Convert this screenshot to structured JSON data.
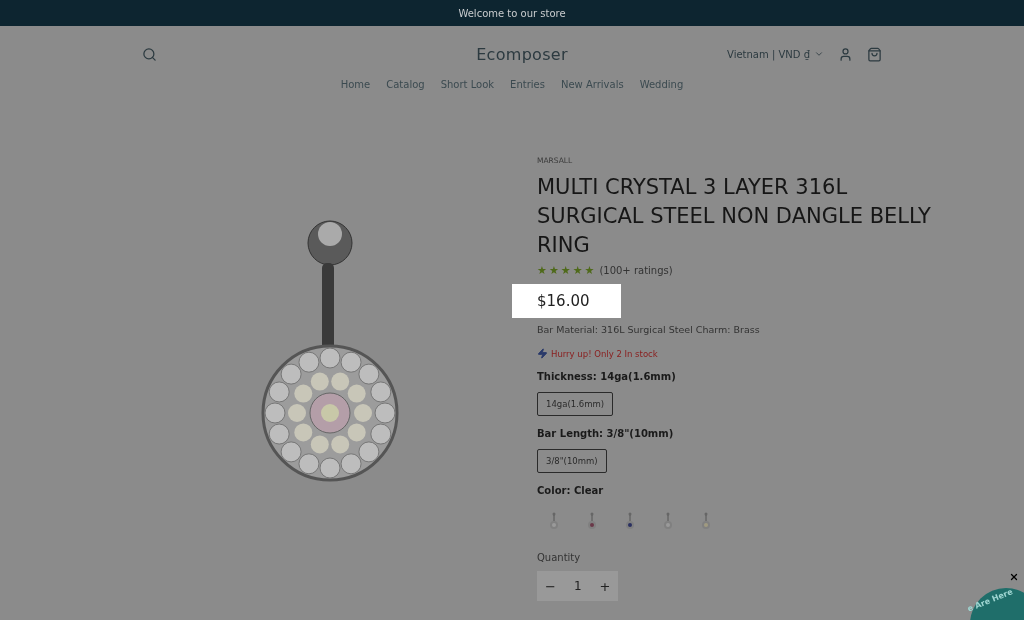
{
  "announcement": "Welcome to our store",
  "header": {
    "logo": "Ecomposer",
    "locale": "Vietnam | VND ₫"
  },
  "nav": [
    "Home",
    "Catalog",
    "Short Look",
    "Entries",
    "New Arrivals",
    "Wedding"
  ],
  "product": {
    "vendor": "MARSALL",
    "title": "MULTI CRYSTAL 3 LAYER 316L SURGICAL STEEL NON DANGLE BELLY RING",
    "stars": 5,
    "ratings": "(100+ ratings)",
    "price": "$16.00",
    "description": "Bar Material: 316L Surgical Steel Charm: Brass",
    "stock": "Hurry up! Only 2 In stock",
    "options": [
      {
        "label": "Thickness: 14ga(1.6mm)",
        "values": [
          {
            "label": "14ga(1.6mm)",
            "selected": true
          }
        ]
      },
      {
        "label": "Bar Length: 3/8\"(10mm)",
        "values": [
          {
            "label": "3/8\"(10mm)",
            "selected": true
          }
        ]
      }
    ],
    "color_label": "Color: Clear",
    "swatches": [
      {
        "color": "#9a9a9a"
      },
      {
        "color": "#6a3848"
      },
      {
        "color": "#2a3060"
      },
      {
        "color": "#9a9a9a"
      },
      {
        "color": "#a09a80"
      }
    ],
    "quantity_label": "Quantity",
    "quantity": "1",
    "minus": "−",
    "plus": "+"
  },
  "widget": {
    "text": "e Are Here"
  }
}
